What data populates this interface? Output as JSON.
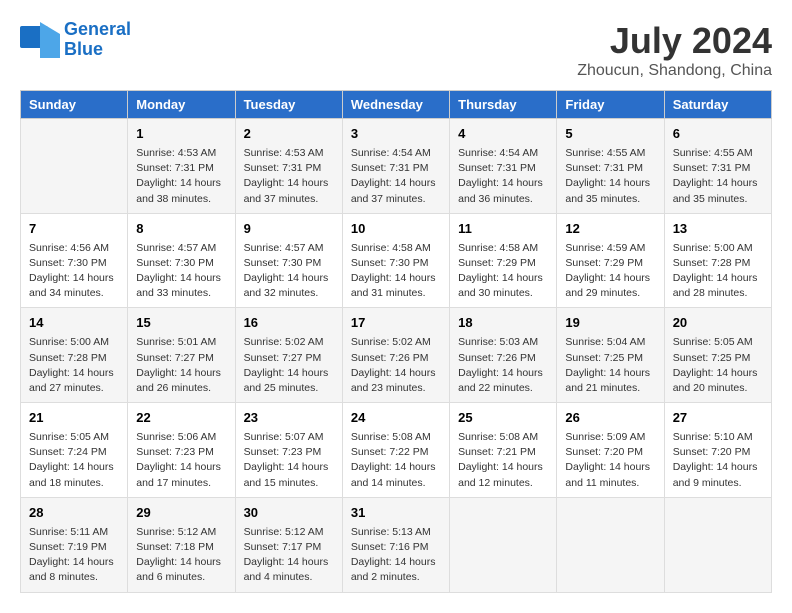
{
  "header": {
    "logo_line1": "General",
    "logo_line2": "Blue",
    "month_title": "July 2024",
    "location": "Zhoucun, Shandong, China"
  },
  "days_of_week": [
    "Sunday",
    "Monday",
    "Tuesday",
    "Wednesday",
    "Thursday",
    "Friday",
    "Saturday"
  ],
  "weeks": [
    [
      {
        "day": "",
        "content": ""
      },
      {
        "day": "1",
        "content": "Sunrise: 4:53 AM\nSunset: 7:31 PM\nDaylight: 14 hours\nand 38 minutes."
      },
      {
        "day": "2",
        "content": "Sunrise: 4:53 AM\nSunset: 7:31 PM\nDaylight: 14 hours\nand 37 minutes."
      },
      {
        "day": "3",
        "content": "Sunrise: 4:54 AM\nSunset: 7:31 PM\nDaylight: 14 hours\nand 37 minutes."
      },
      {
        "day": "4",
        "content": "Sunrise: 4:54 AM\nSunset: 7:31 PM\nDaylight: 14 hours\nand 36 minutes."
      },
      {
        "day": "5",
        "content": "Sunrise: 4:55 AM\nSunset: 7:31 PM\nDaylight: 14 hours\nand 35 minutes."
      },
      {
        "day": "6",
        "content": "Sunrise: 4:55 AM\nSunset: 7:31 PM\nDaylight: 14 hours\nand 35 minutes."
      }
    ],
    [
      {
        "day": "7",
        "content": "Sunrise: 4:56 AM\nSunset: 7:30 PM\nDaylight: 14 hours\nand 34 minutes."
      },
      {
        "day": "8",
        "content": "Sunrise: 4:57 AM\nSunset: 7:30 PM\nDaylight: 14 hours\nand 33 minutes."
      },
      {
        "day": "9",
        "content": "Sunrise: 4:57 AM\nSunset: 7:30 PM\nDaylight: 14 hours\nand 32 minutes."
      },
      {
        "day": "10",
        "content": "Sunrise: 4:58 AM\nSunset: 7:30 PM\nDaylight: 14 hours\nand 31 minutes."
      },
      {
        "day": "11",
        "content": "Sunrise: 4:58 AM\nSunset: 7:29 PM\nDaylight: 14 hours\nand 30 minutes."
      },
      {
        "day": "12",
        "content": "Sunrise: 4:59 AM\nSunset: 7:29 PM\nDaylight: 14 hours\nand 29 minutes."
      },
      {
        "day": "13",
        "content": "Sunrise: 5:00 AM\nSunset: 7:28 PM\nDaylight: 14 hours\nand 28 minutes."
      }
    ],
    [
      {
        "day": "14",
        "content": "Sunrise: 5:00 AM\nSunset: 7:28 PM\nDaylight: 14 hours\nand 27 minutes."
      },
      {
        "day": "15",
        "content": "Sunrise: 5:01 AM\nSunset: 7:27 PM\nDaylight: 14 hours\nand 26 minutes."
      },
      {
        "day": "16",
        "content": "Sunrise: 5:02 AM\nSunset: 7:27 PM\nDaylight: 14 hours\nand 25 minutes."
      },
      {
        "day": "17",
        "content": "Sunrise: 5:02 AM\nSunset: 7:26 PM\nDaylight: 14 hours\nand 23 minutes."
      },
      {
        "day": "18",
        "content": "Sunrise: 5:03 AM\nSunset: 7:26 PM\nDaylight: 14 hours\nand 22 minutes."
      },
      {
        "day": "19",
        "content": "Sunrise: 5:04 AM\nSunset: 7:25 PM\nDaylight: 14 hours\nand 21 minutes."
      },
      {
        "day": "20",
        "content": "Sunrise: 5:05 AM\nSunset: 7:25 PM\nDaylight: 14 hours\nand 20 minutes."
      }
    ],
    [
      {
        "day": "21",
        "content": "Sunrise: 5:05 AM\nSunset: 7:24 PM\nDaylight: 14 hours\nand 18 minutes."
      },
      {
        "day": "22",
        "content": "Sunrise: 5:06 AM\nSunset: 7:23 PM\nDaylight: 14 hours\nand 17 minutes."
      },
      {
        "day": "23",
        "content": "Sunrise: 5:07 AM\nSunset: 7:23 PM\nDaylight: 14 hours\nand 15 minutes."
      },
      {
        "day": "24",
        "content": "Sunrise: 5:08 AM\nSunset: 7:22 PM\nDaylight: 14 hours\nand 14 minutes."
      },
      {
        "day": "25",
        "content": "Sunrise: 5:08 AM\nSunset: 7:21 PM\nDaylight: 14 hours\nand 12 minutes."
      },
      {
        "day": "26",
        "content": "Sunrise: 5:09 AM\nSunset: 7:20 PM\nDaylight: 14 hours\nand 11 minutes."
      },
      {
        "day": "27",
        "content": "Sunrise: 5:10 AM\nSunset: 7:20 PM\nDaylight: 14 hours\nand 9 minutes."
      }
    ],
    [
      {
        "day": "28",
        "content": "Sunrise: 5:11 AM\nSunset: 7:19 PM\nDaylight: 14 hours\nand 8 minutes."
      },
      {
        "day": "29",
        "content": "Sunrise: 5:12 AM\nSunset: 7:18 PM\nDaylight: 14 hours\nand 6 minutes."
      },
      {
        "day": "30",
        "content": "Sunrise: 5:12 AM\nSunset: 7:17 PM\nDaylight: 14 hours\nand 4 minutes."
      },
      {
        "day": "31",
        "content": "Sunrise: 5:13 AM\nSunset: 7:16 PM\nDaylight: 14 hours\nand 2 minutes."
      },
      {
        "day": "",
        "content": ""
      },
      {
        "day": "",
        "content": ""
      },
      {
        "day": "",
        "content": ""
      }
    ]
  ]
}
